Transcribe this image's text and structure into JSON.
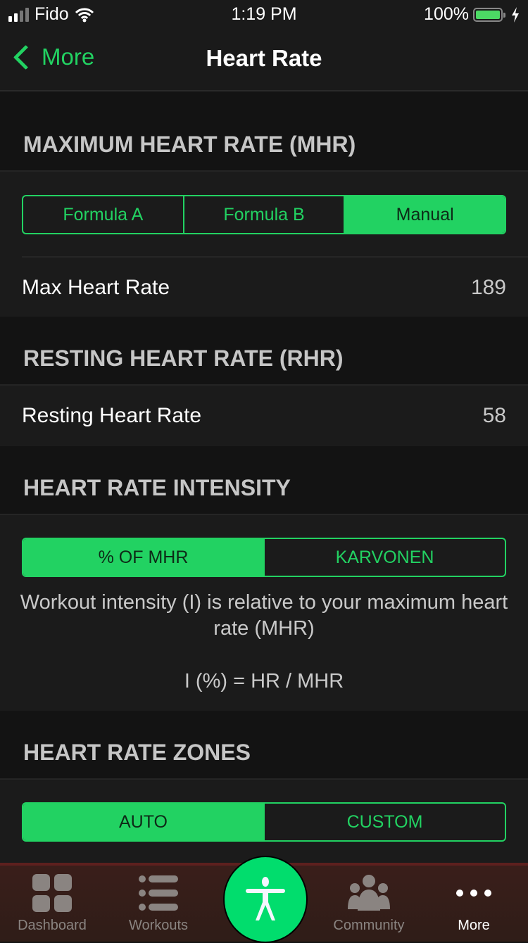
{
  "status_bar": {
    "carrier": "Fido",
    "time": "1:19 PM",
    "battery": "100%"
  },
  "nav": {
    "back_label": "More",
    "title": "Heart Rate"
  },
  "mhr": {
    "header": "MAXIMUM HEART RATE (MHR)",
    "segments": [
      "Formula A",
      "Formula B",
      "Manual"
    ],
    "selected": "Manual",
    "row_label": "Max Heart Rate",
    "row_value": "189"
  },
  "rhr": {
    "header": "RESTING HEART RATE (RHR)",
    "row_label": "Resting Heart Rate",
    "row_value": "58"
  },
  "intensity": {
    "header": "HEART RATE INTENSITY",
    "segments": [
      "% OF MHR",
      "KARVONEN"
    ],
    "selected": "% OF MHR",
    "description": "Workout intensity (I) is relative to your maximum heart rate (MHR)",
    "formula": "I (%) = HR / MHR"
  },
  "zones": {
    "header": "HEART RATE ZONES",
    "segments": [
      "AUTO",
      "CUSTOM"
    ],
    "selected": "AUTO"
  },
  "tabbar": {
    "items": [
      {
        "label": "Dashboard",
        "icon": "grid-icon"
      },
      {
        "label": "Workouts",
        "icon": "list-icon"
      },
      {
        "label": "",
        "icon": "person-icon"
      },
      {
        "label": "Community",
        "icon": "group-icon"
      },
      {
        "label": "More",
        "icon": "more-icon"
      }
    ],
    "active": "More"
  }
}
